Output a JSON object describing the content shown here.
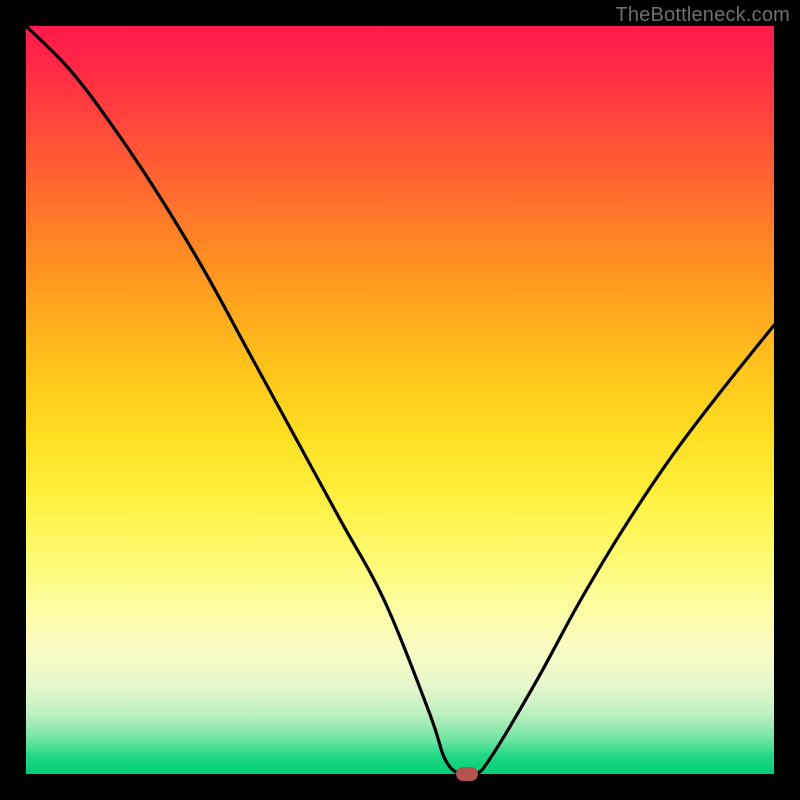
{
  "attribution": "TheBottleneck.com",
  "colors": {
    "gradient_top": "#ff1a4d",
    "gradient_bottom": "#00cf74",
    "curve": "#000000",
    "marker": "#b5534b",
    "frame": "#000000"
  },
  "chart_data": {
    "type": "line",
    "title": "",
    "xlabel": "",
    "ylabel": "",
    "xlim": [
      0,
      100
    ],
    "ylim": [
      0,
      100
    ],
    "grid": false,
    "legend": false,
    "series": [
      {
        "name": "bottleneck-curve",
        "color": "#000000",
        "x": [
          0,
          6,
          12,
          18,
          24,
          30,
          36,
          42,
          48,
          54,
          56,
          58,
          60,
          62,
          68,
          74,
          80,
          86,
          92,
          100
        ],
        "values": [
          100,
          94,
          86,
          77,
          67,
          56,
          45,
          34,
          23,
          8,
          2,
          0,
          0,
          2,
          12,
          23,
          33,
          42,
          50,
          60
        ]
      }
    ],
    "annotations": [
      {
        "name": "minimum-marker",
        "x": 59,
        "y": 0,
        "shape": "pill",
        "color": "#b5534b"
      }
    ]
  }
}
